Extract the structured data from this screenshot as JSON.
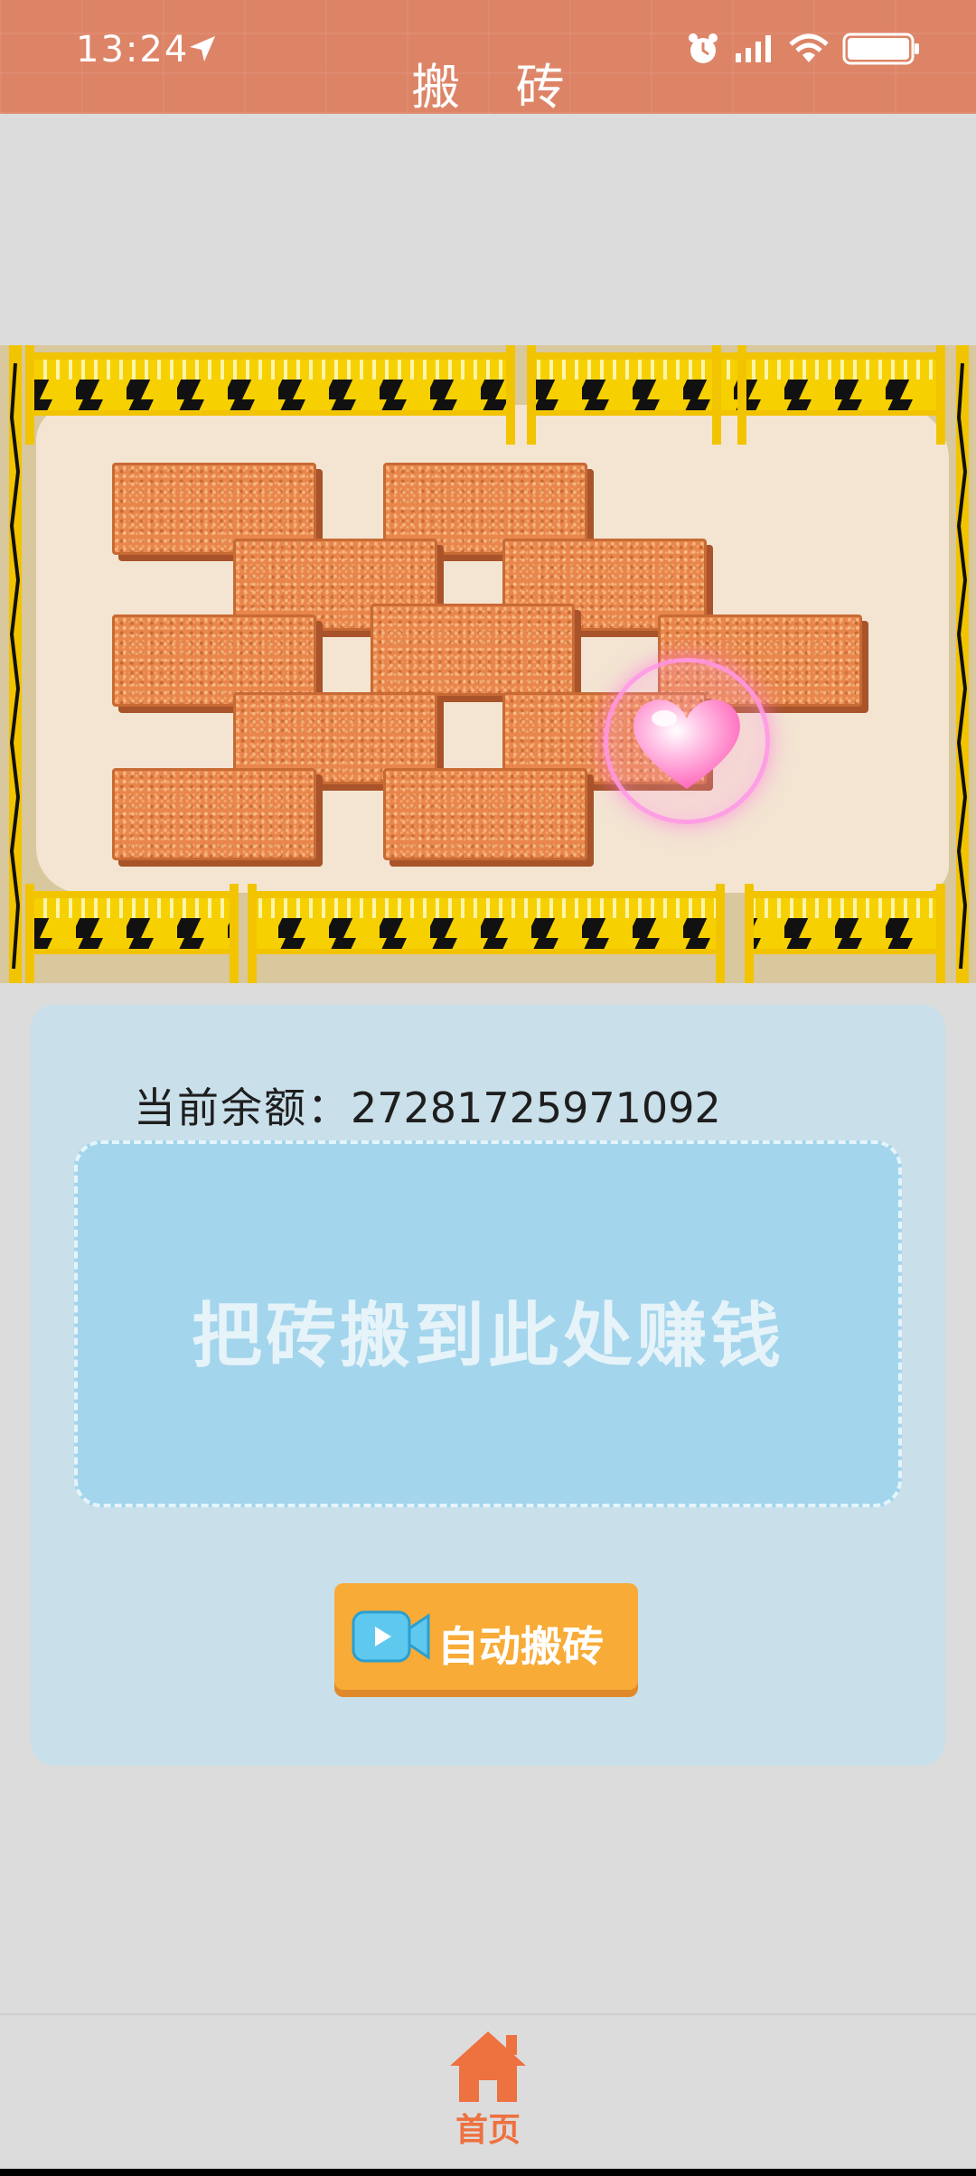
{
  "status_bar": {
    "time": "13:24",
    "icons": [
      "location-arrow-icon",
      "alarm-icon",
      "signal-icon",
      "wifi-icon",
      "battery-icon"
    ]
  },
  "header": {
    "title": "搬 砖"
  },
  "game": {
    "bricks_count": 11,
    "cursor": "heart-icon"
  },
  "panel": {
    "balance_label": "当前余额：",
    "balance_value": "27281725971092",
    "dropzone_text": "把砖搬到此处赚钱",
    "auto_button_label": "自动搬砖",
    "auto_button_icon": "video-camera-icon"
  },
  "bottom_nav": {
    "items": [
      {
        "label": "首页",
        "icon": "home-icon"
      }
    ]
  },
  "colors": {
    "header_bg": "#dd8467",
    "page_bg": "#dcdcdc",
    "panel_bg": "#c9dfe9",
    "dropzone_bg": "#a3d5ec",
    "button_bg": "#f8ab36",
    "brick": "#e9864c",
    "nav_accent": "#ee7140"
  }
}
